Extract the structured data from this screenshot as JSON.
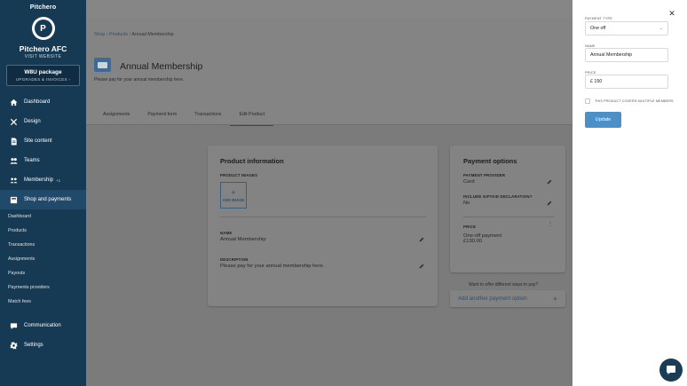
{
  "sidebar": {
    "brand": "Pitchero",
    "crest_letter": "P",
    "club_name": "Pitchero AFC",
    "visit_label": "VISIT WEBSITE",
    "package_title": "W8U package",
    "package_sub": "UPGRADES & INVOICES ›",
    "nav": [
      {
        "label": "Dashboard",
        "icon": "home-icon"
      },
      {
        "label": "Design",
        "icon": "tools-icon"
      },
      {
        "label": "Site content",
        "icon": "document-icon"
      },
      {
        "label": "Teams",
        "icon": "users-icon"
      },
      {
        "label": "Membership",
        "icon": "group-icon",
        "badge": "+1"
      },
      {
        "label": "Shop and payments",
        "icon": "shop-icon"
      }
    ],
    "subnav": [
      "Dashboard",
      "Products",
      "Transactions",
      "Assignments",
      "Payouts",
      "Payments providers",
      "Match fees"
    ],
    "nav_bottom": [
      {
        "label": "Communication",
        "icon": "chat-icon"
      },
      {
        "label": "Settings",
        "icon": "gear-icon"
      }
    ]
  },
  "header": {
    "breadcrumb": [
      "Shop",
      "Products",
      "Annual Membership"
    ],
    "title": "Annual Membership",
    "description": "Please pay for your annual membership here.",
    "tabs": [
      "Assignments",
      "Payment form",
      "Transactions",
      "Edit Product"
    ],
    "active_tab": "Edit Product"
  },
  "product_info": {
    "title": "Product information",
    "images_label": "PRODUCT IMAGES",
    "add_image_label": "ADD IMAGE",
    "name_label": "NAME",
    "name_value": "Annual Membership",
    "description_label": "DESCRIPTION",
    "description_value": "Please pay for your annual membership here."
  },
  "payment_options": {
    "title": "Payment options",
    "provider_label": "PAYMENT PROVIDER",
    "provider_value": "Card",
    "giftaid_label": "INCLUDE GIFTAID DECLARATION?",
    "giftaid_value": "No",
    "price_label": "PRICE",
    "price_type": "One-off payment",
    "price_value": "£130.00",
    "offer_question": "Want to offer different ways to pay?",
    "add_option_label": "Add another payment option"
  },
  "panel": {
    "payment_type_label": "PAYMENT TYPE",
    "payment_type_value": "One off",
    "name_label": "NAME",
    "name_value": "Annual Membership",
    "price_label": "PRICE",
    "price_value": "£ 150",
    "multiple_members_label": "THIS PRODUCT COVERS MULTIPLE MEMBERS",
    "update_label": "Update"
  },
  "colors": {
    "sidebar_bg": "#173a54",
    "accent": "#4c90c8",
    "link": "#2d4f6e"
  }
}
